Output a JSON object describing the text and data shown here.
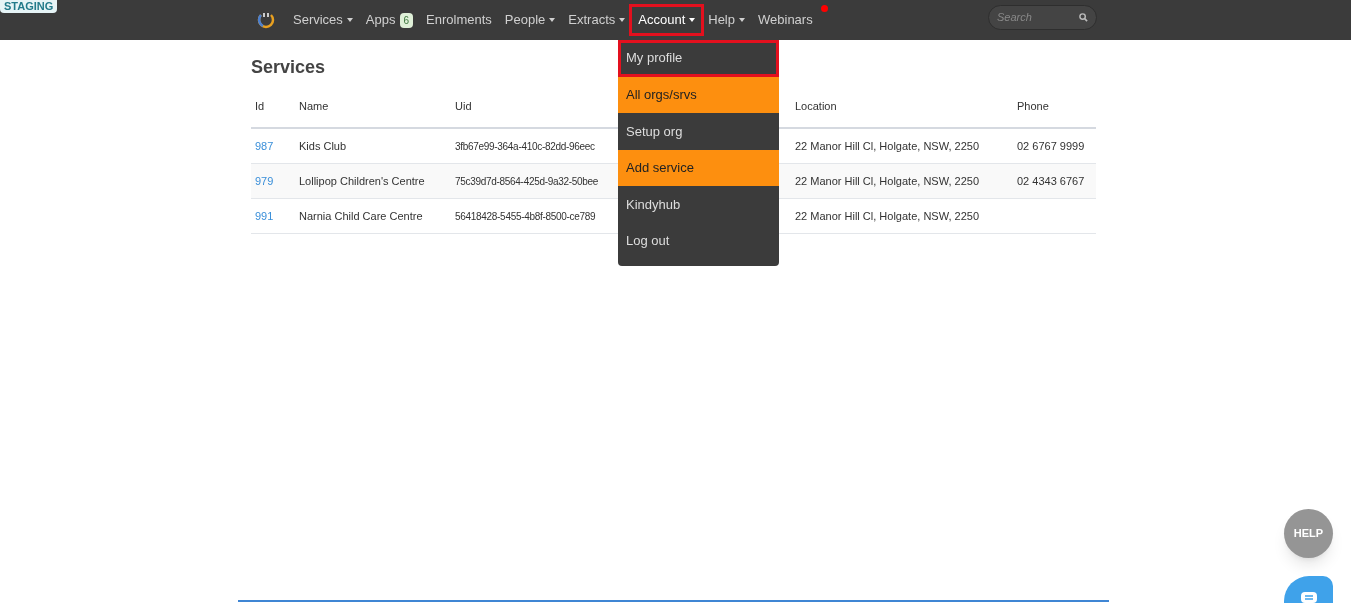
{
  "badge": "STAGING",
  "nav": [
    {
      "label": "Services",
      "caret": true,
      "selected": false,
      "outlined": false
    },
    {
      "label": "Apps",
      "count": "6",
      "caret": false,
      "selected": false,
      "outlined": false
    },
    {
      "label": "Enrolments",
      "caret": false,
      "selected": false,
      "outlined": false
    },
    {
      "label": "People",
      "caret": true,
      "selected": false,
      "outlined": false
    },
    {
      "label": "Extracts",
      "caret": true,
      "selected": false,
      "outlined": false
    },
    {
      "label": "Account",
      "caret": true,
      "selected": true,
      "outlined": true
    },
    {
      "label": "Help",
      "caret": true,
      "selected": false,
      "outlined": false
    },
    {
      "label": "Webinars",
      "caret": false,
      "selected": false,
      "outlined": false,
      "dot": true
    }
  ],
  "search": {
    "placeholder": "Search"
  },
  "menu": [
    {
      "label": "My profile",
      "highlighted": false,
      "outlined": true
    },
    {
      "label": "All orgs/srvs",
      "highlighted": true,
      "outlined": false
    },
    {
      "label": "Setup org",
      "highlighted": false,
      "outlined": false
    },
    {
      "label": "Add service",
      "highlighted": true,
      "outlined": false
    },
    {
      "label": "Kindyhub",
      "highlighted": false,
      "outlined": false
    },
    {
      "label": "Log out",
      "highlighted": false,
      "outlined": false
    }
  ],
  "page_title": "Services",
  "table": {
    "columns": [
      "Id",
      "Name",
      "Uid",
      "Location",
      "Phone"
    ],
    "rows": [
      [
        "987",
        "Kids Club",
        "3fb67e99-364a-410c-82dd-96eec",
        "22 Manor Hill Cl, Holgate, NSW, 2250",
        "02 6767 9999"
      ],
      [
        "979",
        "Lollipop Children's Centre",
        "75c39d7d-8564-425d-9a32-50bee",
        "22 Manor Hill Cl, Holgate, NSW, 2250",
        "02 4343 6767"
      ],
      [
        "991",
        "Narnia Child Care Centre",
        "56418428-5455-4b8f-8500-ce789",
        "22 Manor Hill Cl, Holgate, NSW, 2250",
        ""
      ]
    ]
  },
  "help_button": "HELP"
}
